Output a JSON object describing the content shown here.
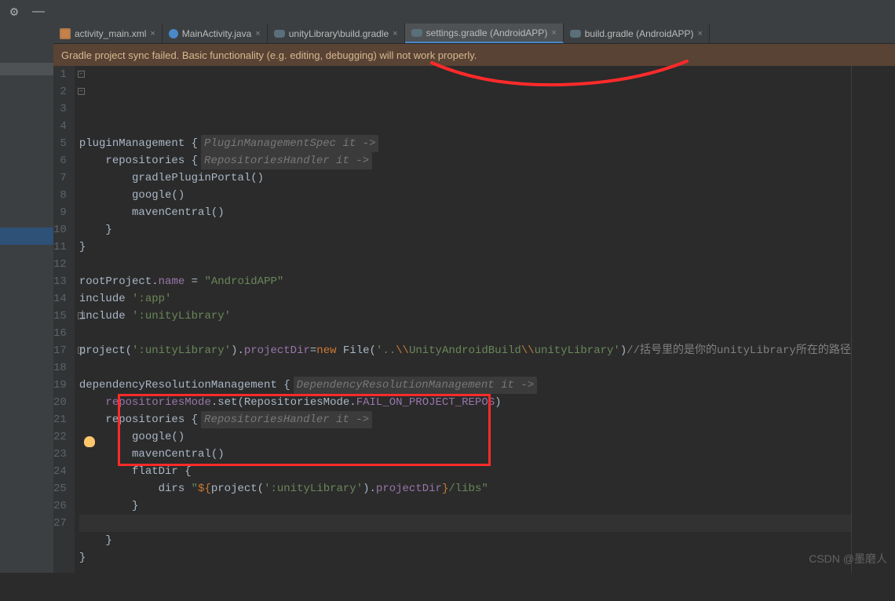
{
  "topbar": {
    "gear": "⚙",
    "minimize": "—"
  },
  "tabs": [
    {
      "icon": "xml",
      "label": "activity_main.xml",
      "active": false
    },
    {
      "icon": "java",
      "label": "MainActivity.java",
      "active": false
    },
    {
      "icon": "gradle",
      "label": "unityLibrary\\build.gradle",
      "active": false
    },
    {
      "icon": "gradle",
      "label": "settings.gradle (AndroidAPP)",
      "active": true
    },
    {
      "icon": "gradle",
      "label": "build.gradle (AndroidAPP)",
      "active": false
    }
  ],
  "notification": "Gradle project sync failed. Basic functionality (e.g. editing, debugging) will not work properly.",
  "code": {
    "lines": [
      {
        "n": 1,
        "seg": [
          {
            "t": "pluginManagement ",
            "c": "id"
          },
          {
            "t": "{",
            "c": "id"
          },
          {
            "t": "PluginManagementSpec it ->",
            "c": "hint"
          }
        ]
      },
      {
        "n": 2,
        "seg": [
          {
            "t": "    repositories ",
            "c": "id"
          },
          {
            "t": "{",
            "c": "id"
          },
          {
            "t": "RepositoriesHandler it ->",
            "c": "hint"
          }
        ]
      },
      {
        "n": 3,
        "seg": [
          {
            "t": "        gradlePluginPortal()",
            "c": "id"
          }
        ]
      },
      {
        "n": 4,
        "seg": [
          {
            "t": "        google()",
            "c": "id"
          }
        ]
      },
      {
        "n": 5,
        "seg": [
          {
            "t": "        mavenCentral()",
            "c": "id"
          }
        ]
      },
      {
        "n": 6,
        "seg": [
          {
            "t": "    }",
            "c": "id"
          }
        ]
      },
      {
        "n": 7,
        "seg": [
          {
            "t": "}",
            "c": "id"
          }
        ]
      },
      {
        "n": 8,
        "seg": []
      },
      {
        "n": 9,
        "seg": [
          {
            "t": "rootProject",
            "c": "id"
          },
          {
            "t": ".",
            "c": "id"
          },
          {
            "t": "name",
            "c": "purple"
          },
          {
            "t": " = ",
            "c": "id"
          },
          {
            "t": "\"AndroidAPP\"",
            "c": "str"
          }
        ]
      },
      {
        "n": 10,
        "seg": [
          {
            "t": "include ",
            "c": "id"
          },
          {
            "t": "':app'",
            "c": "str"
          }
        ]
      },
      {
        "n": 11,
        "seg": [
          {
            "t": "include ",
            "c": "id"
          },
          {
            "t": "':unityLibrary'",
            "c": "str"
          }
        ]
      },
      {
        "n": 12,
        "seg": []
      },
      {
        "n": 13,
        "seg": [
          {
            "t": "project(",
            "c": "id"
          },
          {
            "t": "':unityLibrary'",
            "c": "str"
          },
          {
            "t": ").",
            "c": "id"
          },
          {
            "t": "projectDir",
            "c": "purple"
          },
          {
            "t": "=",
            "c": "id"
          },
          {
            "t": "new ",
            "c": "kw"
          },
          {
            "t": "File(",
            "c": "id"
          },
          {
            "t": "'..",
            "c": "str"
          },
          {
            "t": "\\\\",
            "c": "kw"
          },
          {
            "t": "UnityAndroidBuild",
            "c": "str"
          },
          {
            "t": "\\\\",
            "c": "kw"
          },
          {
            "t": "unityLibrary'",
            "c": "str"
          },
          {
            "t": ")",
            "c": "id"
          },
          {
            "t": "//括号里的是你的unityLibrary所在的路径",
            "c": "comment"
          }
        ]
      },
      {
        "n": 14,
        "seg": []
      },
      {
        "n": 15,
        "seg": [
          {
            "t": "dependencyResolutionManagement ",
            "c": "id"
          },
          {
            "t": "{",
            "c": "id"
          },
          {
            "t": "DependencyResolutionManagement it ->",
            "c": "hint"
          }
        ]
      },
      {
        "n": 16,
        "seg": [
          {
            "t": "    ",
            "c": "id"
          },
          {
            "t": "repositoriesMode",
            "c": "purple"
          },
          {
            "t": ".set(RepositoriesMode.",
            "c": "id"
          },
          {
            "t": "FAIL_ON_PROJECT_REPOS",
            "c": "purple"
          },
          {
            "t": ")",
            "c": "id"
          }
        ]
      },
      {
        "n": 17,
        "seg": [
          {
            "t": "    repositories ",
            "c": "id"
          },
          {
            "t": "{",
            "c": "id"
          },
          {
            "t": "RepositoriesHandler it ->",
            "c": "hint"
          }
        ]
      },
      {
        "n": 18,
        "seg": [
          {
            "t": "        google()",
            "c": "id"
          }
        ]
      },
      {
        "n": 19,
        "seg": [
          {
            "t": "        mavenCentral()",
            "c": "id"
          }
        ]
      },
      {
        "n": 20,
        "seg": [
          {
            "t": "        flatDir ",
            "c": "id"
          },
          {
            "t": "{",
            "c": "id"
          }
        ]
      },
      {
        "n": 21,
        "seg": [
          {
            "t": "            dirs ",
            "c": "id"
          },
          {
            "t": "\"",
            "c": "str"
          },
          {
            "t": "${",
            "c": "kw"
          },
          {
            "t": "project(",
            "c": "id"
          },
          {
            "t": "':unityLibrary'",
            "c": "str"
          },
          {
            "t": ").",
            "c": "id"
          },
          {
            "t": "projectDir",
            "c": "purple"
          },
          {
            "t": "}",
            "c": "kw"
          },
          {
            "t": "/libs",
            "c": "str"
          },
          {
            "t": "\"",
            "c": "str"
          }
        ]
      },
      {
        "n": 22,
        "seg": [
          {
            "t": "        }",
            "c": "id"
          }
        ]
      },
      {
        "n": 23,
        "seg": [],
        "current": true
      },
      {
        "n": 24,
        "seg": [
          {
            "t": "    }",
            "c": "id"
          }
        ]
      },
      {
        "n": 25,
        "seg": [
          {
            "t": "}",
            "c": "id"
          }
        ]
      },
      {
        "n": 26,
        "seg": []
      },
      {
        "n": 27,
        "seg": []
      }
    ]
  },
  "watermark": "CSDN @墨磨人"
}
